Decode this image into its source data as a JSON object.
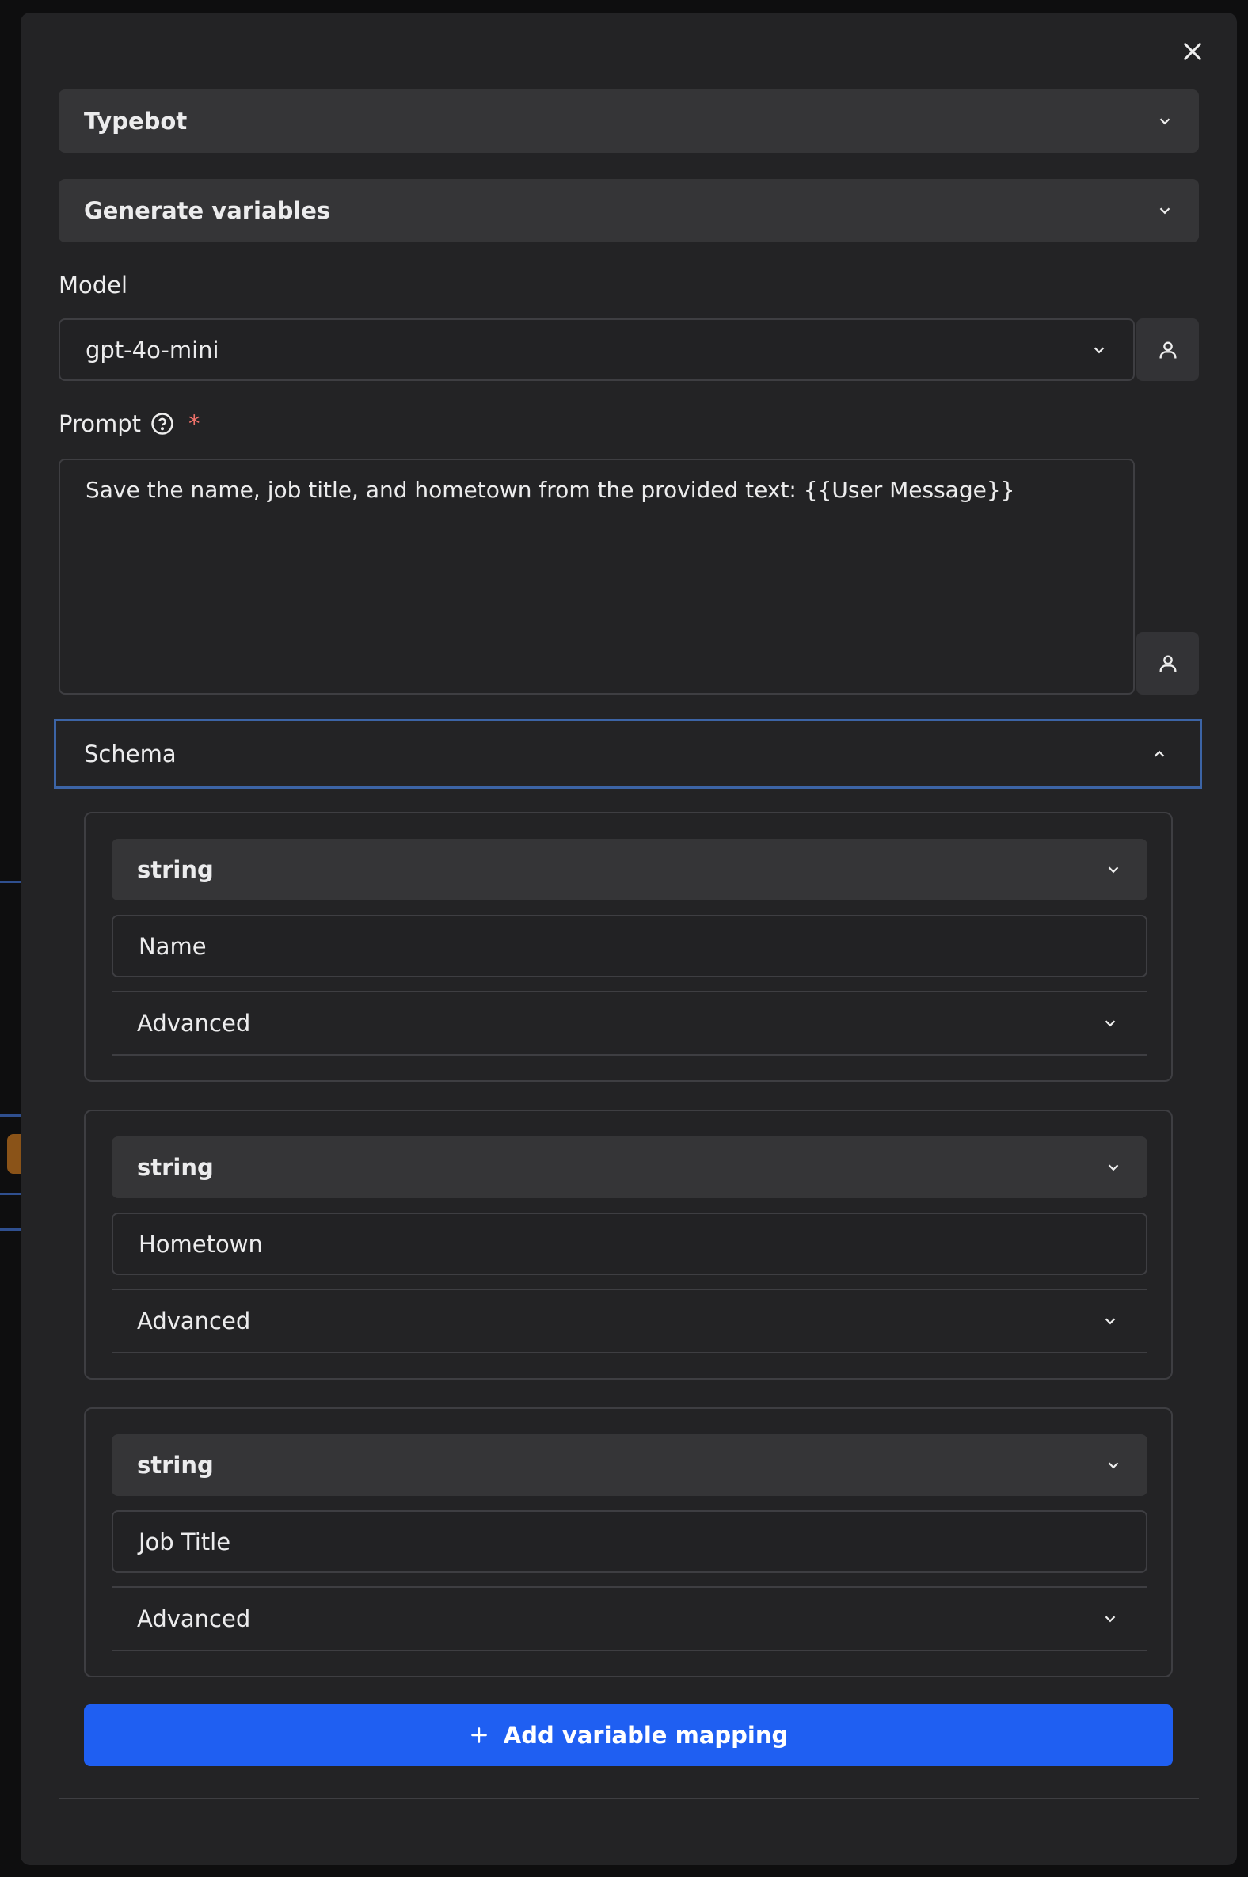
{
  "integration_select": {
    "value": "Typebot"
  },
  "action_select": {
    "value": "Generate variables"
  },
  "model": {
    "label": "Model",
    "value": "gpt-4o-mini"
  },
  "prompt": {
    "label": "Prompt",
    "required_marker": "*",
    "value": "Save the name, job title, and hometown from the provided text: {{User Message}}"
  },
  "schema": {
    "label": "Schema",
    "items": [
      {
        "type": "string",
        "name": "Name",
        "advanced_label": "Advanced"
      },
      {
        "type": "string",
        "name": "Hometown",
        "advanced_label": "Advanced"
      },
      {
        "type": "string",
        "name": "Job Title",
        "advanced_label": "Advanced"
      }
    ]
  },
  "add_button": {
    "label": "Add variable mapping"
  },
  "colors": {
    "accent": "#1f5ff2",
    "focus_border": "#3c64a6",
    "required": "#f0726b",
    "panel": "#232325"
  }
}
